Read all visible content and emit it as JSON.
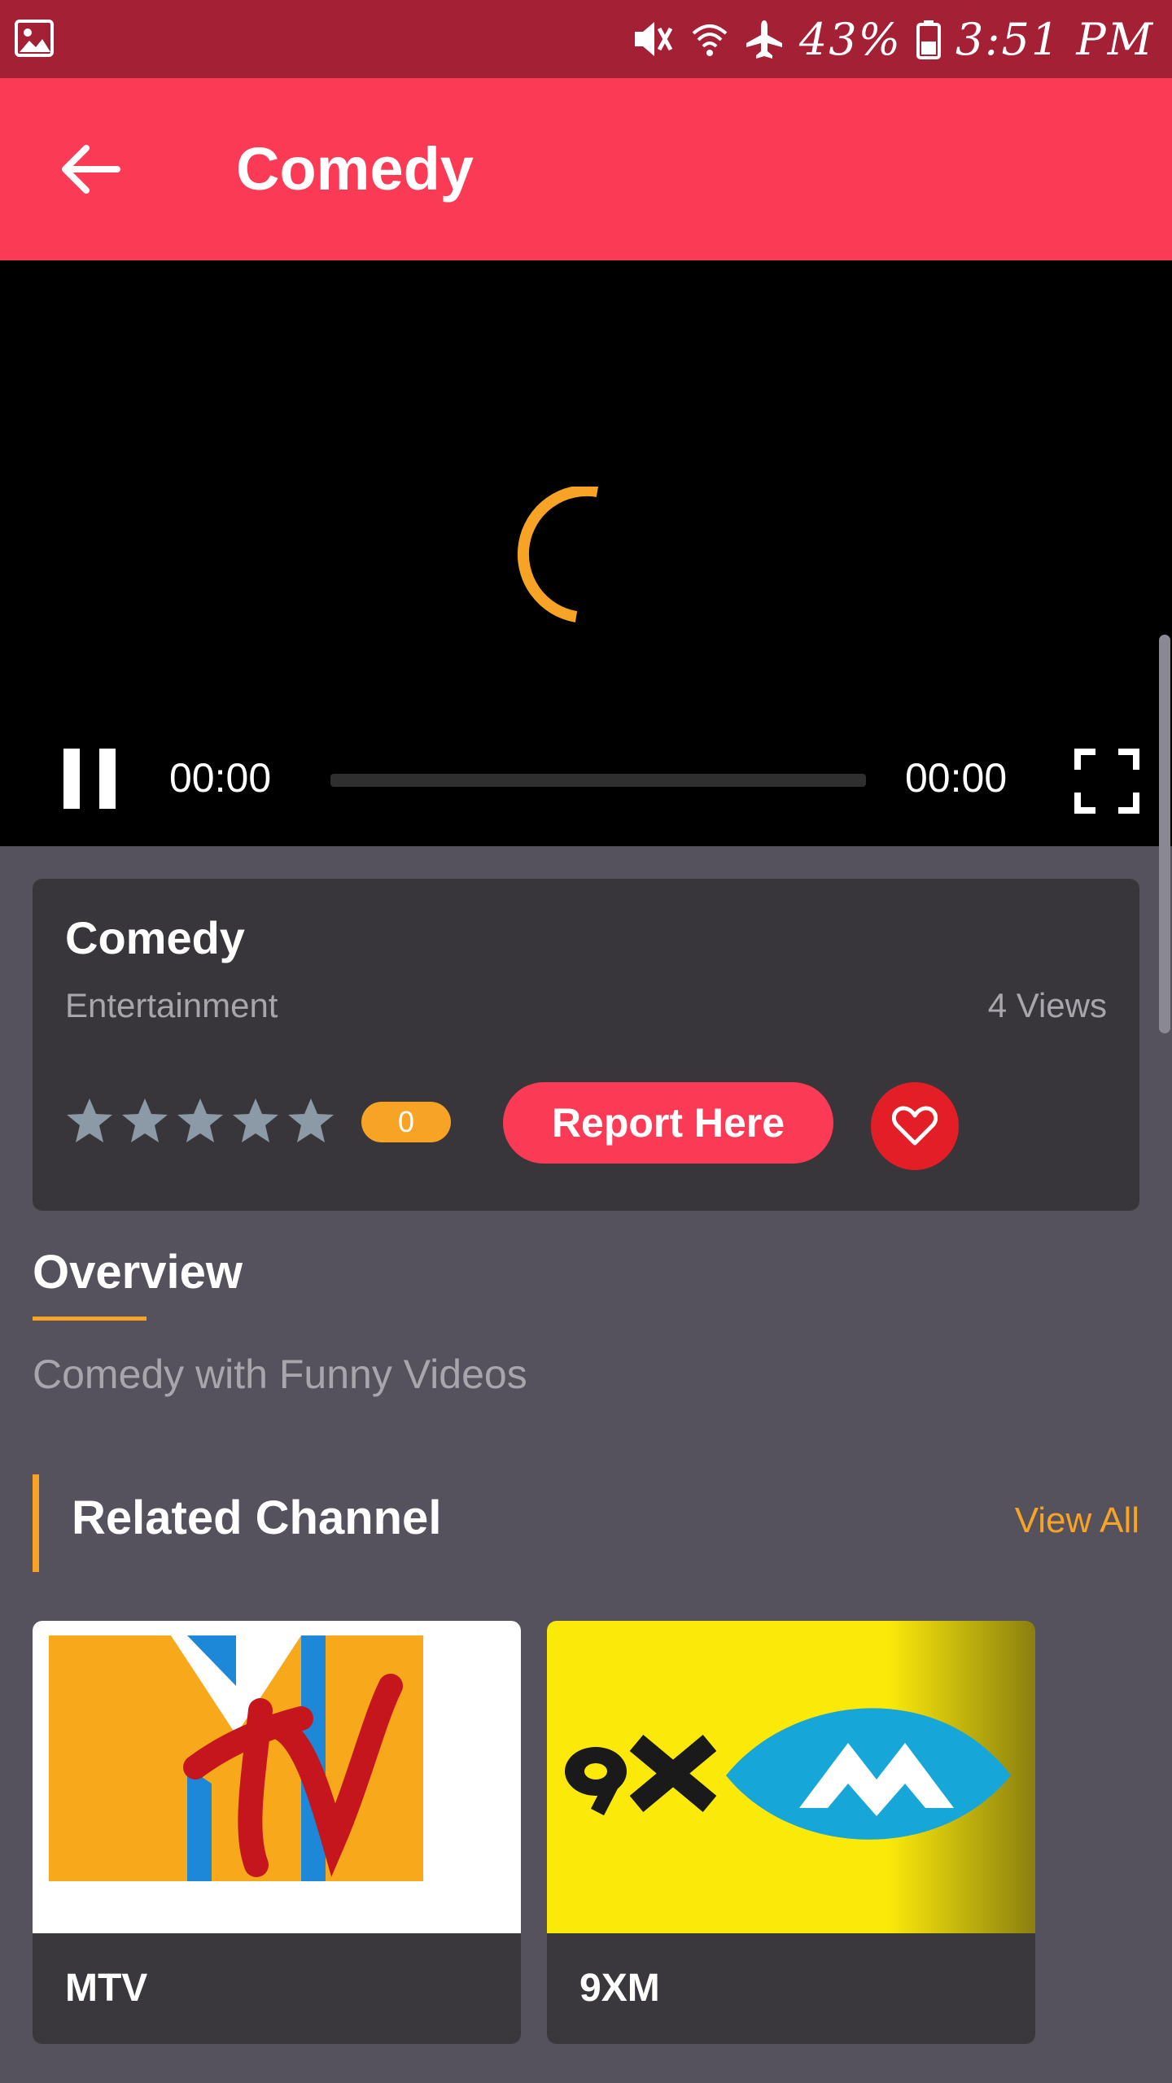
{
  "status_bar": {
    "battery": "43%",
    "time": "3:51 PM",
    "icons": [
      "gallery-icon",
      "mute-icon",
      "wifi-icon",
      "airplane-icon",
      "battery-icon"
    ]
  },
  "appbar": {
    "title": "Comedy",
    "back_icon": "arrow-left-icon"
  },
  "player": {
    "current_time": "00:00",
    "duration": "00:00",
    "progress": 0
  },
  "info": {
    "title": "Comedy",
    "category": "Entertainment",
    "views": "4 Views",
    "rating_count": "0",
    "stars": 5,
    "report_label": "Report Here"
  },
  "overview": {
    "title": "Overview",
    "text": "Comedy with Funny Videos"
  },
  "related": {
    "title": "Related Channel",
    "view_all": "View All",
    "channels": [
      {
        "name": "MTV"
      },
      {
        "name": "9XM"
      }
    ]
  },
  "colors": {
    "status_bar": "#a32035",
    "appbar": "#fb3a55",
    "accent": "#f7a325",
    "background": "#55525e",
    "card": "#38363b"
  }
}
